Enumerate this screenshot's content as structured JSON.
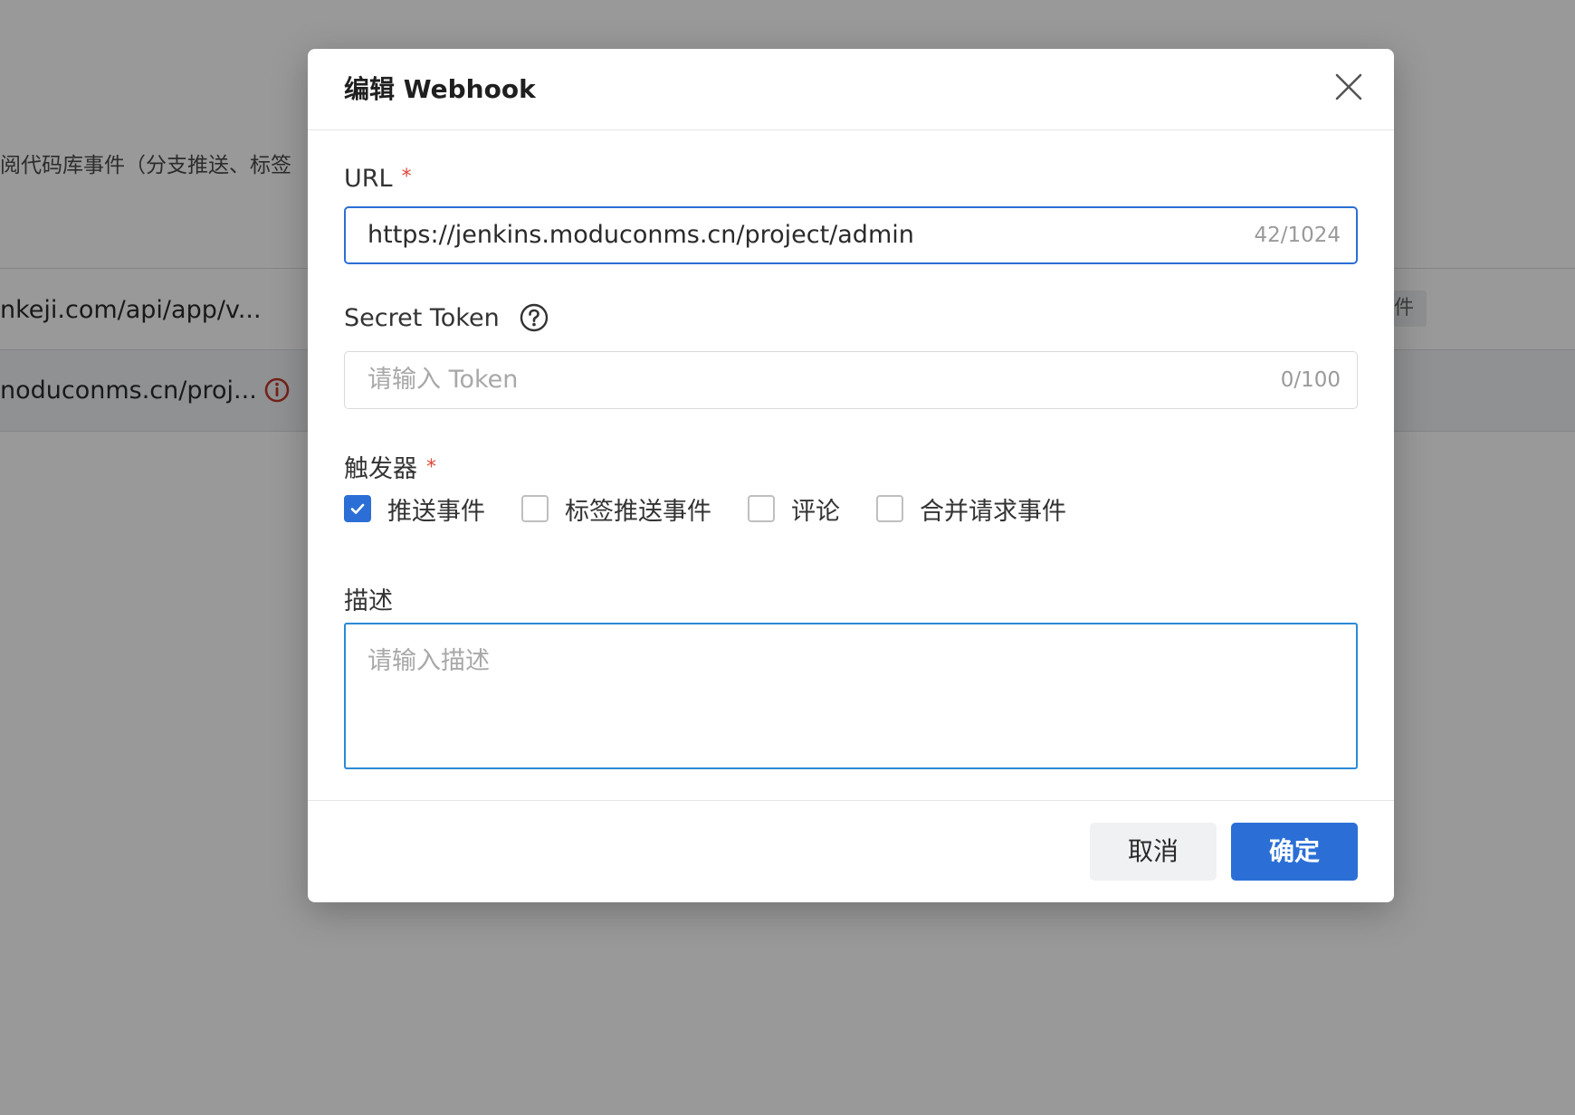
{
  "background": {
    "description_fragment": "阅代码库事件（分支推送、标签",
    "rows": [
      {
        "url": "nkeji.com/api/app/v...",
        "tag": "件"
      },
      {
        "url": "noduconms.cn/proj..."
      }
    ]
  },
  "modal": {
    "title": "编辑 Webhook",
    "url_field": {
      "label": "URL",
      "required_mark": "*",
      "value": "https://jenkins.moduconms.cn/project/admin",
      "count": "42/1024"
    },
    "token_field": {
      "label": "Secret Token",
      "placeholder": "请输入 Token",
      "count": "0/100"
    },
    "trigger_field": {
      "label": "触发器",
      "required_mark": "*",
      "options": [
        {
          "label": "推送事件",
          "checked": true
        },
        {
          "label": "标签推送事件",
          "checked": false
        },
        {
          "label": "评论",
          "checked": false
        },
        {
          "label": "合并请求事件",
          "checked": false
        }
      ]
    },
    "description_field": {
      "label": "描述",
      "placeholder": "请输入描述"
    },
    "footer": {
      "cancel_label": "取消",
      "ok_label": "确定"
    }
  },
  "colors": {
    "primary": "#2b6fd6",
    "required": "#e0473a",
    "warning_icon": "#c0392b"
  }
}
